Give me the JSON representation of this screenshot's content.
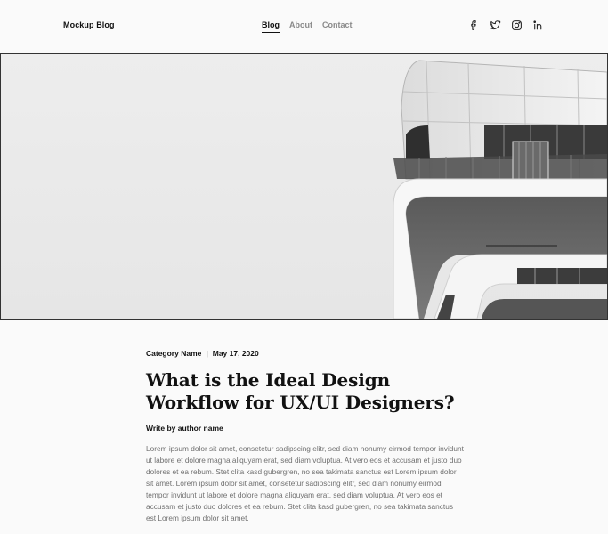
{
  "header": {
    "brand": "Mockup Blog",
    "nav": [
      {
        "label": "Blog",
        "active": true
      },
      {
        "label": "About",
        "active": false
      },
      {
        "label": "Contact",
        "active": false
      }
    ],
    "social_icons": [
      "facebook-icon",
      "twitter-icon",
      "instagram-icon",
      "linkedin-icon"
    ]
  },
  "hero": {
    "image": "black-and-white modern building with curved balconies against pale sky"
  },
  "article": {
    "category": "Category Name",
    "separator": "|",
    "date": "May 17, 2020",
    "title": "What is the Ideal Design Workflow for UX/UI Designers?",
    "author": "Write by author name",
    "body": "Lorem ipsum dolor sit amet, consetetur sadipscing elitr, sed diam nonumy eirmod tempor invidunt ut labore et dolore magna aliquyam erat, sed diam voluptua. At vero eos et accusam et justo duo dolores et ea rebum. Stet clita kasd gubergren, no sea takimata sanctus est Lorem ipsum dolor sit amet. Lorem ipsum dolor sit amet, consetetur sadipscing elitr, sed diam nonumy eirmod tempor invidunt ut labore et dolore magna aliquyam erat, sed diam voluptua. At vero eos et accusam et justo duo dolores et ea rebum. Stet clita kasd gubergren, no sea takimata sanctus est Lorem ipsum dolor sit amet."
  }
}
